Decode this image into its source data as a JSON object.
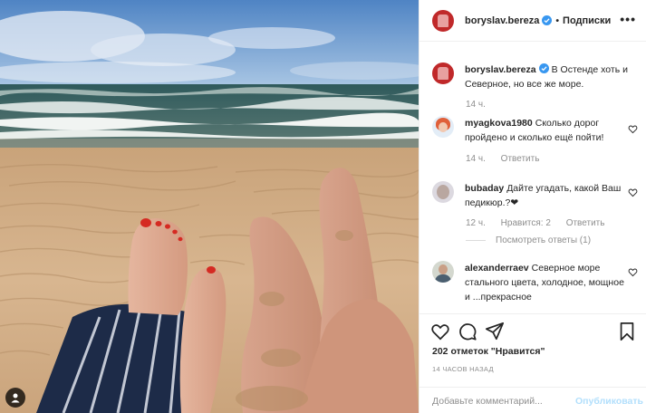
{
  "post": {
    "author": "boryslav.bereza",
    "follow_label": "Подписки",
    "more_label": "•••",
    "caption": {
      "username": "boryslav.bereza",
      "text": "В Остенде хоть и Северное, но все же море.",
      "time": "14 ч."
    },
    "comments": [
      {
        "username": "myagkova1980",
        "text": "Сколько дорог пройдено и сколько ещё пойти!",
        "time": "14 ч.",
        "reply_label": "Ответить"
      },
      {
        "username": "bubaday",
        "text": "Дайте угадать, какой Ваш педикюр.?❤",
        "time": "12 ч.",
        "likes_label": "Нравится: 2",
        "reply_label": "Ответить",
        "view_replies": "Посмотреть ответы (1)"
      },
      {
        "username": "alexanderraev",
        "text": "Северное море стального цвета, холодное, мощное и ...прекрасное"
      }
    ],
    "likes_count": "202",
    "likes_text": "отметок \"Нравится\"",
    "time_ago": "14 часов назад",
    "comment_placeholder": "Добавьте комментарий...",
    "publish_label": "Опубликовать"
  },
  "icons": {
    "verified": "verified-badge-icon",
    "heart": "heart-icon",
    "comment": "comment-icon",
    "share": "share-icon",
    "bookmark": "bookmark-icon",
    "more": "more-icon",
    "profile_badge": "profile-badge-icon"
  },
  "colors": {
    "accent": "#0095f6",
    "verified": "#3897f0",
    "muted_text": "#8e8e8e",
    "publish_disabled": "#b2dffc",
    "border": "#efefef"
  }
}
